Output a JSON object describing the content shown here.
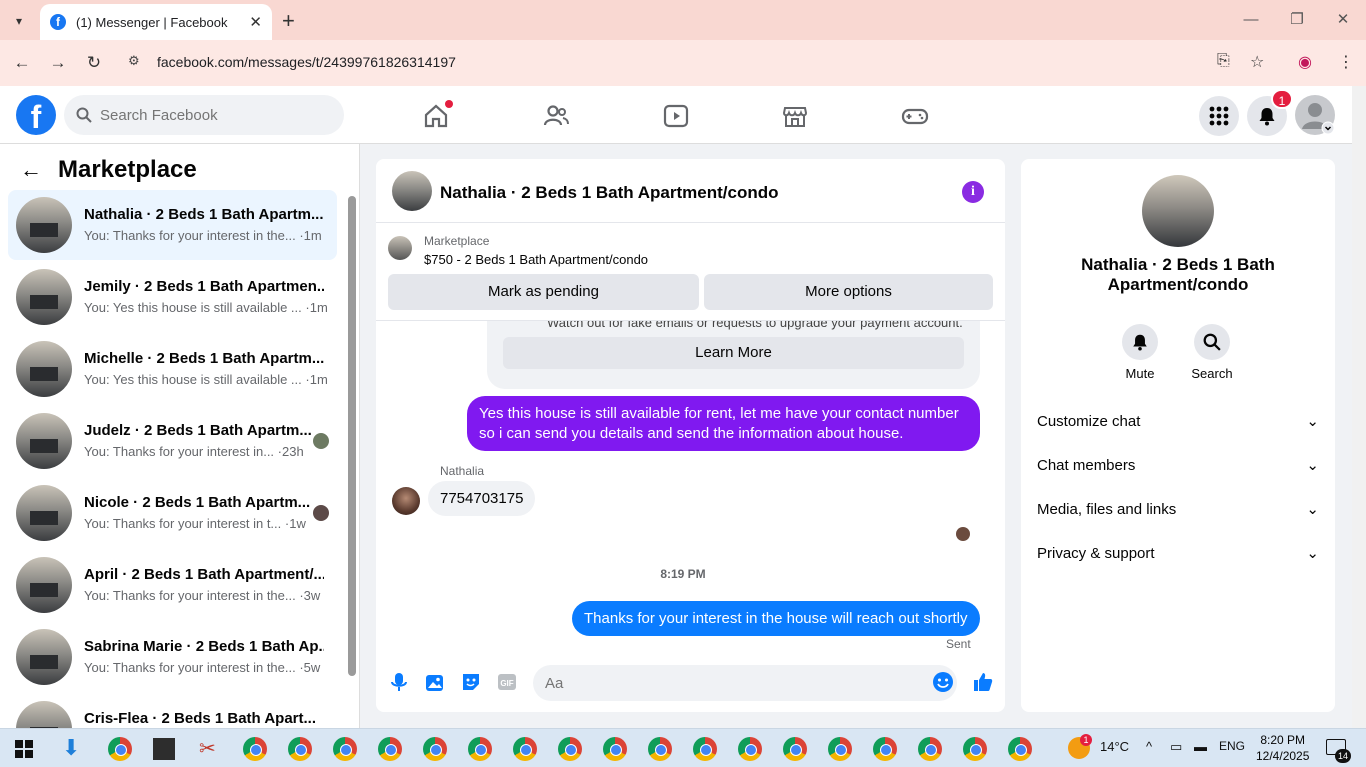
{
  "browser": {
    "tab_title": "(1) Messenger | Facebook",
    "url": "facebook.com/messages/t/24399761826314197"
  },
  "header": {
    "search_placeholder": "Search Facebook",
    "notification_count": "1"
  },
  "sidebar": {
    "title": "Marketplace",
    "conversations": [
      {
        "name": "Nathalia · 2 Beds 1 Bath Apartm...",
        "snippet": "You: Thanks for your interest in the... ·1m"
      },
      {
        "name": "Jemily · 2 Beds 1 Bath Apartmen...",
        "snippet": "You: Yes this house is still available ... ·1m"
      },
      {
        "name": "Michelle · 2 Beds 1 Bath Apartm...",
        "snippet": "You: Yes this house is still available ... ·1m"
      },
      {
        "name": "Judelz · 2 Beds 1 Bath Apartm...",
        "snippet": "You: Thanks for your interest in... ·23h"
      },
      {
        "name": "Nicole · 2 Beds 1 Bath Apartm...",
        "snippet": "You: Thanks for your interest in t... ·1w"
      },
      {
        "name": "April · 2 Beds 1 Bath Apartment/...",
        "snippet": "You: Thanks for your interest in the... ·3w"
      },
      {
        "name": "Sabrina Marie · 2 Beds 1 Bath Ap...",
        "snippet": "You: Thanks for your interest in the... ·5w"
      },
      {
        "name": "Cris-Flea · 2 Beds 1 Bath Apart...",
        "snippet": ""
      }
    ]
  },
  "chat": {
    "title": "Nathalia · 2 Beds 1 Bath Apartment/condo",
    "marketplace_label": "Marketplace",
    "listing": "$750 - 2 Beds 1 Bath Apartment/condo",
    "mark_pending": "Mark as pending",
    "more_options": "More options",
    "warning_text": "Watch out for fake emails or requests to upgrade your payment account.",
    "learn_more": "Learn More",
    "msg_sent_1": "Yes this house is still available for rent, let me have your contact number so i can send you details and send the information about house.",
    "sender_name": "Nathalia",
    "msg_received": "7754703175",
    "timestamp": "8:19 PM",
    "msg_sent_2": "Thanks for your interest in the house will reach out shortly",
    "sent_label": "Sent",
    "composer_placeholder": "Aa"
  },
  "right_panel": {
    "name": "Nathalia · 2 Beds 1 Bath Apartment/condo",
    "mute": "Mute",
    "search": "Search",
    "sections": [
      "Customize chat",
      "Chat members",
      "Media, files and links",
      "Privacy & support"
    ]
  },
  "taskbar": {
    "weather": "14°C",
    "weather_badge": "1",
    "lang": "ENG",
    "time": "8:20 PM",
    "date": "12/4/2025",
    "notif_count": "14"
  },
  "colors": {
    "fb_blue": "#1877f2",
    "purple_bubble": "#8019f0",
    "blue_bubble": "#0a7cff"
  }
}
